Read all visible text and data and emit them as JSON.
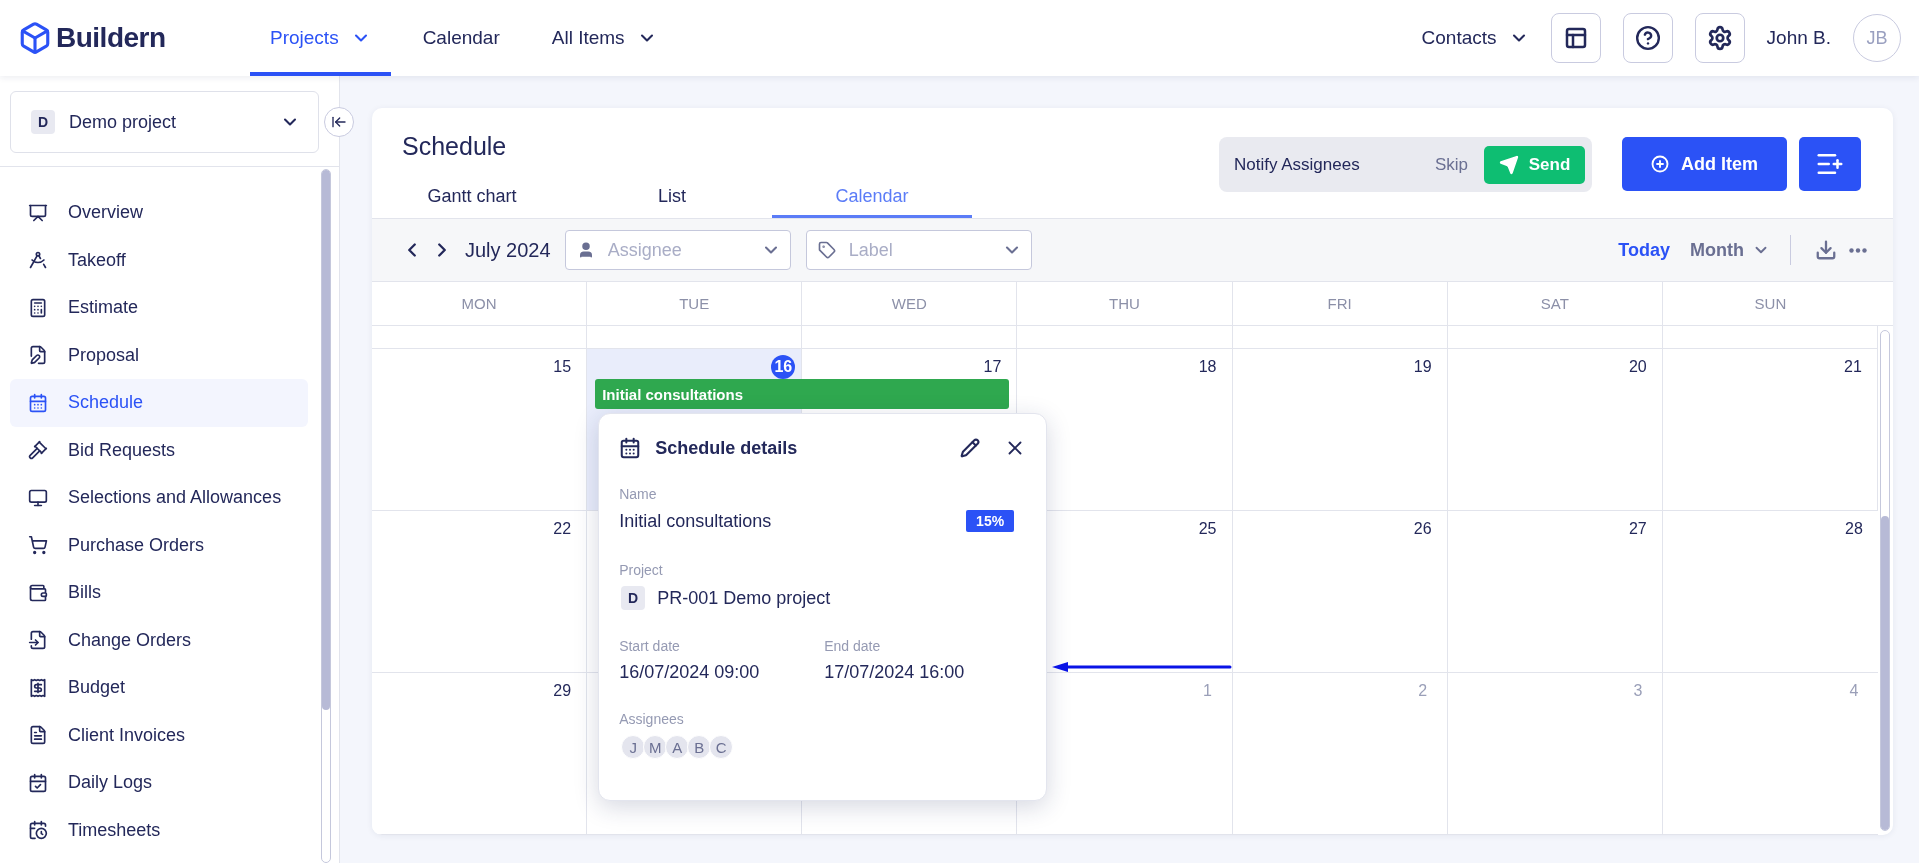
{
  "logo": {
    "text": "Buildern"
  },
  "nav": [
    {
      "label": "Projects",
      "selected": true,
      "caret": true
    },
    {
      "label": "Calendar",
      "selected": false
    },
    {
      "label": "All Items",
      "selected": false,
      "caret": true
    }
  ],
  "header_right": {
    "contacts": "Contacts",
    "user_name": "John B.",
    "avatar_initials": "JB"
  },
  "sidebar": {
    "project": {
      "badge": "D",
      "name": "Demo project"
    },
    "items": [
      {
        "label": "Overview",
        "selected": false
      },
      {
        "label": "Takeoff",
        "selected": false
      },
      {
        "label": "Estimate",
        "selected": false
      },
      {
        "label": "Proposal",
        "selected": false
      },
      {
        "label": "Schedule",
        "selected": true
      },
      {
        "label": "Bid Requests",
        "selected": false
      },
      {
        "label": "Selections and Allowances",
        "selected": false
      },
      {
        "label": "Purchase Orders",
        "selected": false
      },
      {
        "label": "Bills",
        "selected": false
      },
      {
        "label": "Change Orders",
        "selected": false
      },
      {
        "label": "Budget",
        "selected": false
      },
      {
        "label": "Client Invoices",
        "selected": false
      },
      {
        "label": "Daily Logs",
        "selected": false
      },
      {
        "label": "Timesheets",
        "selected": false
      }
    ]
  },
  "schedule": {
    "title": "Schedule",
    "tabs": [
      {
        "label": "Gantt chart",
        "selected": false
      },
      {
        "label": "List",
        "selected": false
      },
      {
        "label": "Calendar",
        "selected": true
      }
    ],
    "notify": {
      "label": "Notify Assignees",
      "skip": "Skip",
      "send": "Send"
    },
    "add_item": "Add Item",
    "toolbar": {
      "month": "July 2024",
      "assignee_placeholder": "Assignee",
      "label_placeholder": "Label",
      "today": "Today",
      "view": "Month"
    },
    "weekdays": [
      "MON",
      "TUE",
      "WED",
      "THU",
      "FRI",
      "SAT",
      "SUN"
    ],
    "weeks": [
      {
        "events": [
          {
            "title": "Initial consultations"
          }
        ],
        "days": [
          {
            "day": "15",
            "today": false,
            "muted": false
          },
          {
            "day": "16",
            "today": true,
            "muted": false,
            "has_event": true
          },
          {
            "day": "17",
            "today": false,
            "muted": false,
            "has_event": true
          },
          {
            "day": "18",
            "today": false,
            "muted": false
          },
          {
            "day": "19",
            "today": false,
            "muted": false
          },
          {
            "day": "20",
            "today": false,
            "muted": false
          },
          {
            "day": "21",
            "today": false,
            "muted": false
          }
        ]
      },
      {
        "days": [
          {
            "day": "22",
            "today": false,
            "muted": false
          }
        ],
        "days_right": [
          {
            "day": "25",
            "today": false,
            "muted": false
          },
          {
            "day": "26",
            "today": false,
            "muted": false
          },
          {
            "day": "27",
            "today": false,
            "muted": false
          },
          {
            "day": "28",
            "today": false,
            "muted": false
          }
        ]
      },
      {
        "days": [
          {
            "day": "29",
            "today": false,
            "muted": false
          }
        ],
        "days_right": [
          {
            "day": "1",
            "today": false,
            "muted": true
          },
          {
            "day": "2",
            "today": false,
            "muted": true
          },
          {
            "day": "3",
            "today": false,
            "muted": true
          },
          {
            "day": "4",
            "today": false,
            "muted": true
          }
        ]
      }
    ],
    "details": {
      "title": "Schedule details",
      "name_label": "Name",
      "name": "Initial consultations",
      "progress": "15%",
      "project_label": "Project",
      "project_badge": "D",
      "project": "PR-001 Demo project",
      "start_label": "Start date",
      "start": "16/07/2024 09:00",
      "end_label": "End date",
      "end": "17/07/2024 16:00",
      "assignees_label": "Assignees",
      "assignees": [
        "J",
        "M",
        "A",
        "B",
        "C"
      ]
    }
  }
}
